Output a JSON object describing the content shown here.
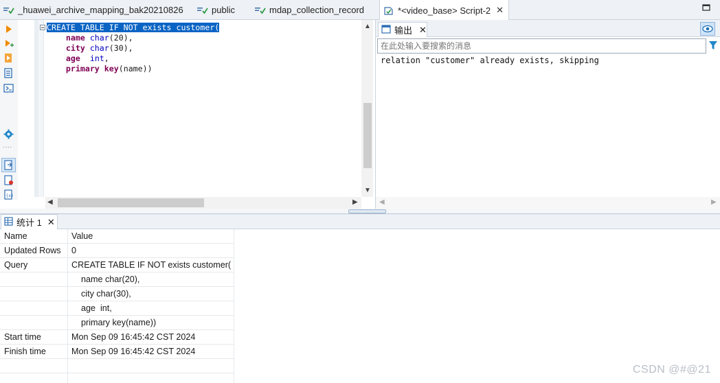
{
  "tabs": [
    {
      "label": "_huawei_archive_mapping_bak20210826",
      "icon": "sql-console-icon"
    },
    {
      "label": "public",
      "icon": "sql-console-icon"
    },
    {
      "label": "mdap_collection_record",
      "icon": "sql-console-icon"
    },
    {
      "label": "*<video_base> Script-2",
      "icon": "script-icon",
      "active": true
    }
  ],
  "editor": {
    "lines": [
      "CREATE TABLE IF NOT exists customer(",
      "    name char(20),",
      "    city char(30),",
      "    age  int,",
      "    primary key(name))"
    ]
  },
  "output": {
    "tab_label": "输出",
    "search_placeholder": "在此处输入要搜索的消息",
    "messages": [
      "relation \"customer\" already exists, skipping"
    ]
  },
  "stats": {
    "tab_label": "统计 1",
    "columns": [
      "Name",
      "Value"
    ],
    "rows": [
      {
        "name": "Updated Rows",
        "value": "0"
      },
      {
        "name": "Query",
        "value": "CREATE TABLE IF NOT exists customer("
      },
      {
        "name": "",
        "value": "    name char(20),"
      },
      {
        "name": "",
        "value": "    city char(30),"
      },
      {
        "name": "",
        "value": "    age  int,"
      },
      {
        "name": "",
        "value": "    primary key(name))"
      },
      {
        "name": "Start time",
        "value": "Mon Sep 09 16:45:42 CST 2024"
      },
      {
        "name": "Finish time",
        "value": "Mon Sep 09 16:45:42 CST 2024"
      }
    ]
  },
  "watermark": "CSDN @#@21",
  "colors": {
    "selection": "#0b64c4",
    "keyword": "#7f0055",
    "type": "#0000c0"
  }
}
